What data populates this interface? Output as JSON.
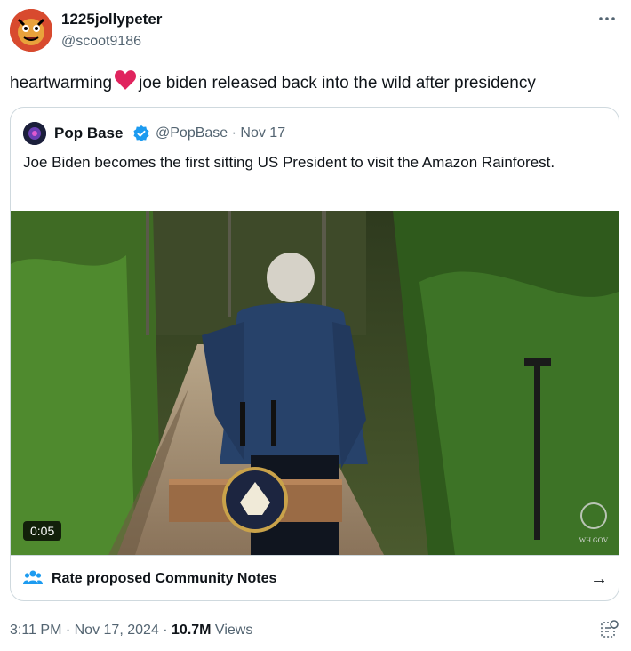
{
  "tweet": {
    "display_name": "1225jollypeter",
    "handle": "@scoot9186",
    "text_before": "heartwarming",
    "text_after": "joe biden released back into the wild after presidency"
  },
  "quote": {
    "name": "Pop Base",
    "handle_date": "@PopBase · Nov 17",
    "text": "Joe Biden becomes the first sitting US President to visit the Amazon Rainforest.",
    "video_duration": "0:05",
    "watermark": "WH.GOV"
  },
  "community_notes": {
    "label": "Rate proposed Community Notes",
    "arrow": "→"
  },
  "meta": {
    "timestamp": "3:11 PM · Nov 17, 2024 · ",
    "views_count": "10.7M",
    "views_label": " Views"
  },
  "colors": {
    "accent": "#1d9bf0",
    "heart": "#e0245e",
    "text": "#0f1419",
    "muted": "#536471"
  }
}
